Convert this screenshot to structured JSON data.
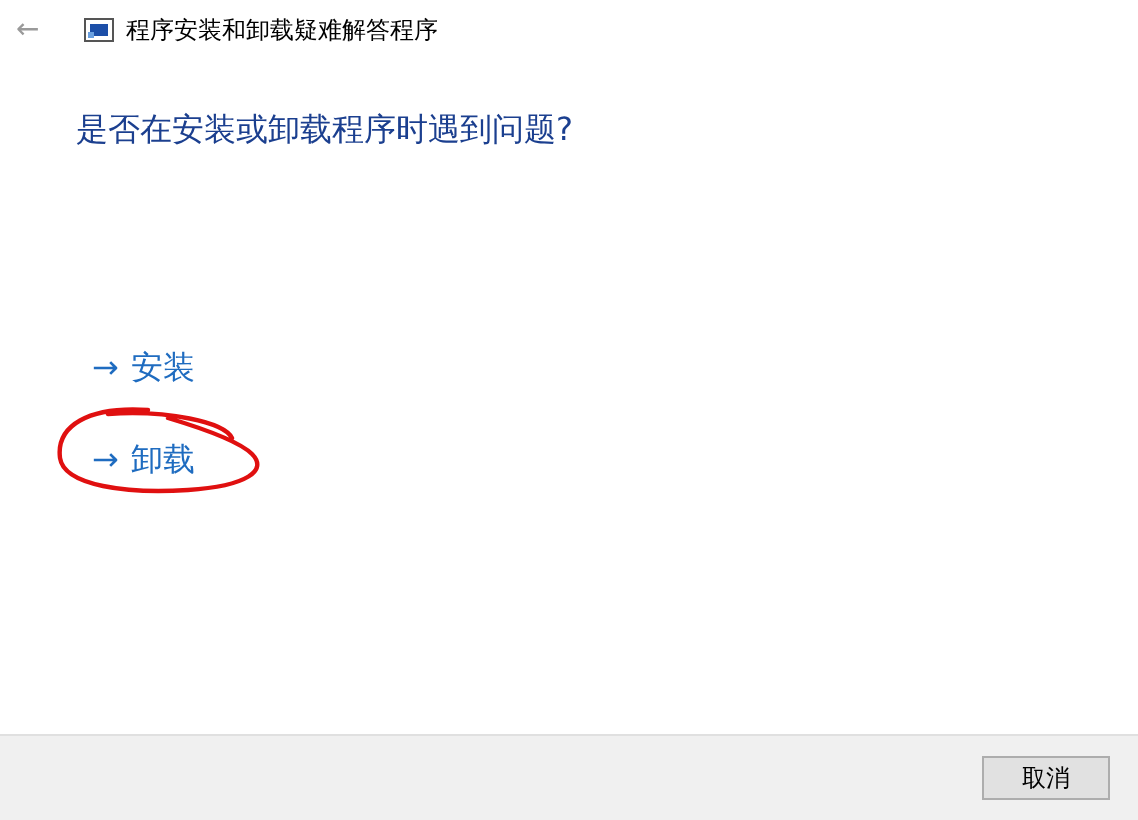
{
  "window": {
    "back": "←",
    "title": "程序安装和卸载疑难解答程序"
  },
  "heading": "是否在安装或卸载程序时遇到问题?",
  "options": [
    {
      "arrow": "→",
      "label": "安装",
      "circled": false
    },
    {
      "arrow": "→",
      "label": "卸载",
      "circled": true
    }
  ],
  "buttons": [
    "取消"
  ]
}
